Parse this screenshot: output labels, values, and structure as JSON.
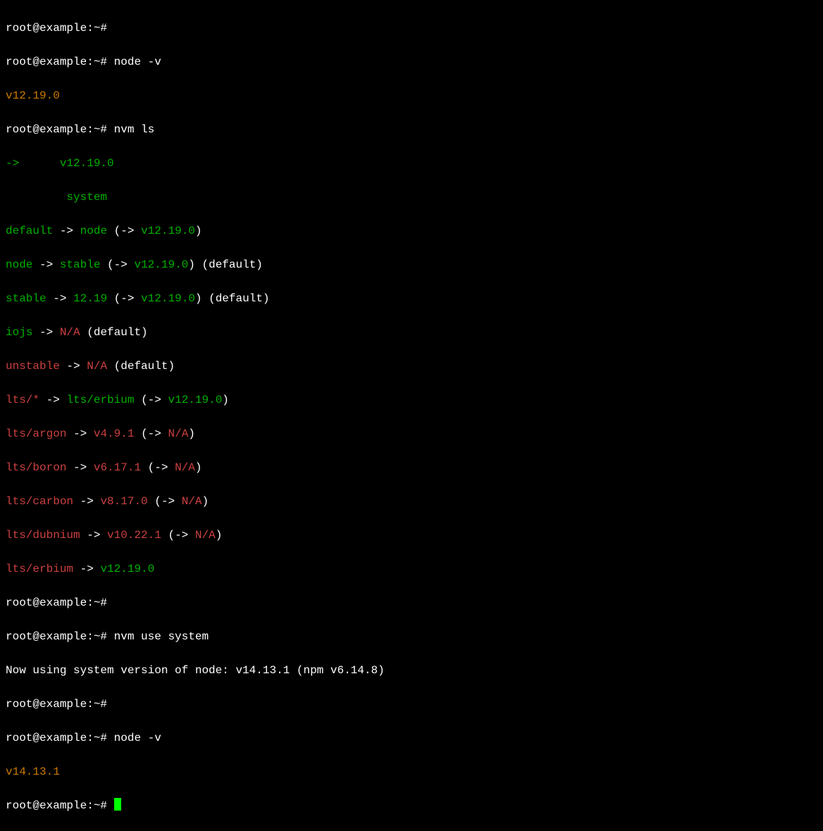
{
  "prompt": "root@example:~#",
  "commands": {
    "node_v1": "node -v",
    "nvm_ls": "nvm ls",
    "nvm_use": "nvm use system",
    "node_v2": "node -v"
  },
  "outputs": {
    "node_version_1": "v12.19.0",
    "node_version_2": "v14.13.1",
    "nvm_use_result": "Now using system version of node: v14.13.1 (npm v6.14.8)"
  },
  "nvm_ls": {
    "arrow": "->",
    "current": "v12.19.0",
    "system": "system",
    "aliases": [
      {
        "name": "default",
        "arrow": "->",
        "target": "node",
        "paren_arrow": "->",
        "paren_version": "v12.19.0",
        "extra": ""
      },
      {
        "name": "node",
        "arrow": "->",
        "target": "stable",
        "paren_arrow": "->",
        "paren_version": "v12.19.0",
        "extra": " (default)"
      },
      {
        "name": "stable",
        "arrow": "->",
        "target": "12.19",
        "paren_arrow": "->",
        "paren_version": "v12.19.0",
        "extra": " (default)"
      }
    ],
    "iojs": {
      "name": "iojs",
      "arrow": "->",
      "na": "N/A",
      "extra": " (default)"
    },
    "unstable": {
      "name": "unstable",
      "arrow": "->",
      "na": "N/A",
      "extra": " (default)"
    },
    "lts_star": {
      "name": "lts/*",
      "arrow": "->",
      "target": "lts/erbium",
      "paren_arrow": "->",
      "paren_version": "v12.19.0"
    },
    "lts_entries": [
      {
        "name": "lts/argon",
        "arrow": "->",
        "version": "v4.9.1",
        "paren_arrow": "->",
        "na": "N/A"
      },
      {
        "name": "lts/boron",
        "arrow": "->",
        "version": "v6.17.1",
        "paren_arrow": "->",
        "na": "N/A"
      },
      {
        "name": "lts/carbon",
        "arrow": "->",
        "version": "v8.17.0",
        "paren_arrow": "->",
        "na": "N/A"
      },
      {
        "name": "lts/dubnium",
        "arrow": "->",
        "version": "v10.22.1",
        "paren_arrow": "->",
        "na": "N/A"
      }
    ],
    "lts_erbium": {
      "name": "lts/erbium",
      "arrow": "->",
      "version": "v12.19.0"
    }
  }
}
